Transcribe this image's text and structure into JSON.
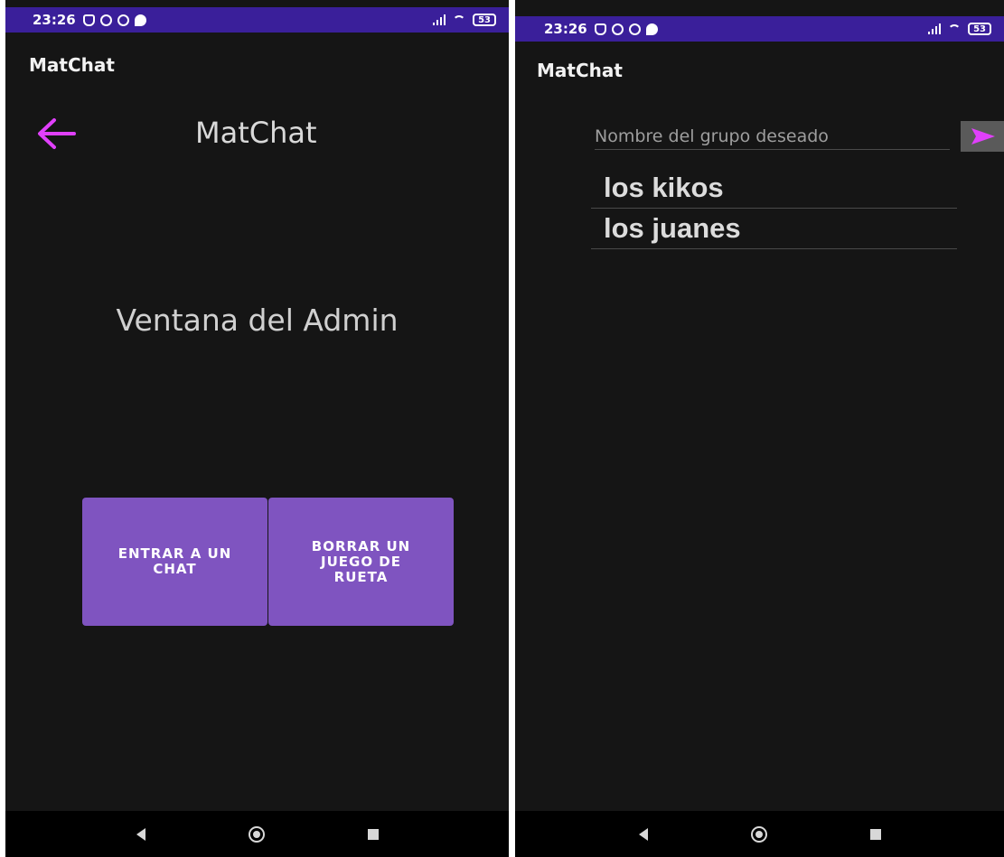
{
  "status_bar": {
    "time": "23:26",
    "battery": "53",
    "icons": [
      "mute-icon",
      "alarm-icon",
      "whatsapp-icon",
      "chat-bubble-icon",
      "signal-icon",
      "wifi-icon",
      "battery-icon"
    ],
    "background": "#3a1f9a"
  },
  "admin_screen": {
    "app_bar_title": "MatChat",
    "header_title": "MatChat",
    "back_icon": "arrow-left-icon",
    "page_title": "Ventana del Admin",
    "buttons": {
      "enter_chat": "ENTRAR A UN CHAT",
      "delete_game": "BORRAR UN JUEGO DE RUETA"
    }
  },
  "group_screen": {
    "app_bar_title": "MatChat",
    "group_input": {
      "placeholder": "Nombre del grupo deseado",
      "value": ""
    },
    "send_icon": "send-icon",
    "groups": [
      "los kikos",
      "los juanes"
    ]
  },
  "nav_bar": {
    "icons": [
      "back-triangle-icon",
      "home-circle-icon",
      "recents-square-icon"
    ]
  },
  "colors": {
    "accent": "#e040fb",
    "button": "#7f54c0",
    "background": "#151515",
    "status_bar": "#3a1f9a"
  }
}
